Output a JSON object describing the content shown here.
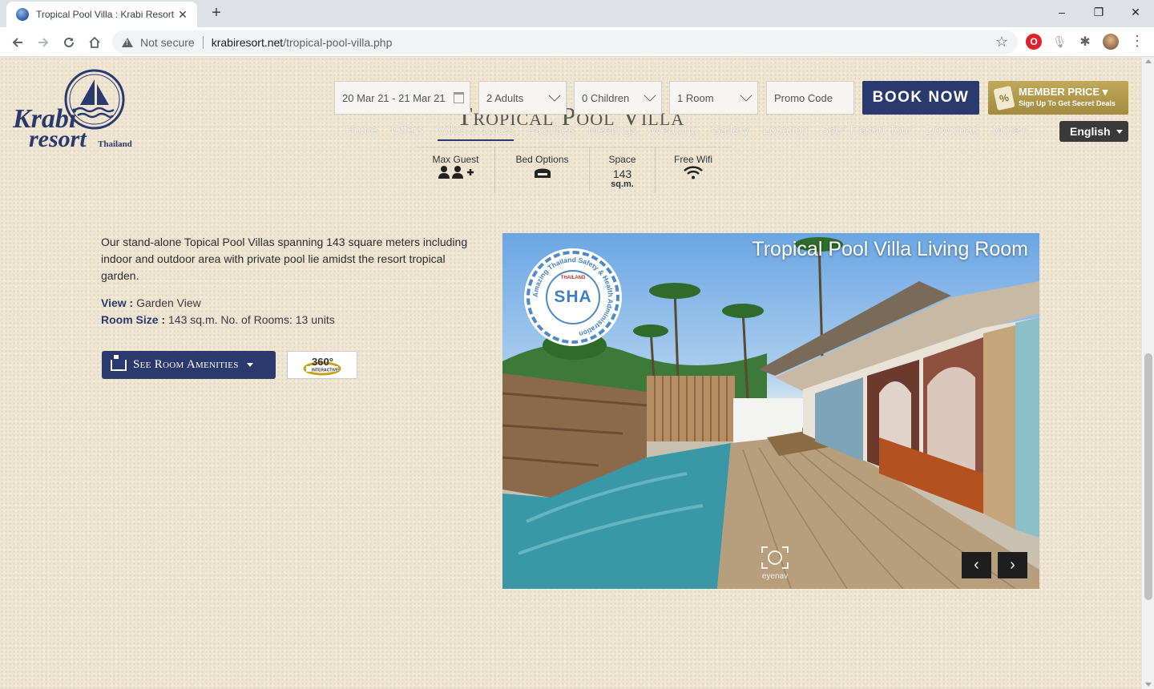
{
  "browser": {
    "tab_title": "Tropical Pool Villa : Krabi Resort A",
    "new_tab": "+",
    "security_label": "Not secure",
    "url_domain": "krabiresort.net",
    "url_path": "/tropical-pool-villa.php",
    "window_controls": [
      "–",
      "❐",
      "✕"
    ],
    "icons": [
      "back-icon",
      "forward-icon",
      "reload-icon",
      "home-icon",
      "star-icon",
      "opera-icon",
      "mic-icon",
      "puzzle-icon",
      "profile-avatar",
      "menu-icon"
    ]
  },
  "logo": {
    "line1": "Krabi",
    "line2": "resort",
    "line3": "Thailand"
  },
  "booking": {
    "dates": "20 Mar 21 - 21 Mar 21",
    "adults": "2 Adults",
    "children": "0 Children",
    "rooms": "1 Room",
    "promo_placeholder": "Promo Code",
    "book_label": "BOOK NOW",
    "member_title": "MEMBER PRICE",
    "member_sub": "Sign Up To Get Secret Deals",
    "member_tag": "%"
  },
  "page_title": "Tropical Pool Villa",
  "nav": {
    "items": [
      "Home",
      "Offers",
      "Villas & Suites",
      "Facilities",
      "Meetings",
      "Wedding",
      "Gallery",
      "Location",
      "360° Resort Tour",
      "Download",
      "More+"
    ],
    "active_index": 2,
    "language": "English"
  },
  "features": [
    {
      "label": "Max Guest",
      "icon": "guests-icon"
    },
    {
      "label": "Bed Options",
      "icon": "bed-icon"
    },
    {
      "label": "Space",
      "value": "143",
      "unit": "sq.m."
    },
    {
      "label": "Free Wifi",
      "icon": "wifi-icon"
    }
  ],
  "description": "Our stand-alone Topical Pool Villas spanning 143 square meters including indoor and outdoor area with private pool lie amidst the resort tropical garden.",
  "details": {
    "view_label": "View :",
    "view_value": " Garden View",
    "size_label": "Room Size :",
    "size_value": " 143 sq.m. No. of Rooms: 13 units"
  },
  "amenities_button": "See Room Amenities",
  "tour_badge": {
    "top": "360°",
    "bottom": "INTERACTIVE"
  },
  "carousel": {
    "caption": "Tropical Pool Villa Living Room",
    "sha_text": "SHA",
    "sha_ring": "Amazing Thailand Safety & Health Administration",
    "sha_logo": "THAILAND",
    "eyenav_label": "eyenav",
    "prev": "‹",
    "next": "›"
  }
}
